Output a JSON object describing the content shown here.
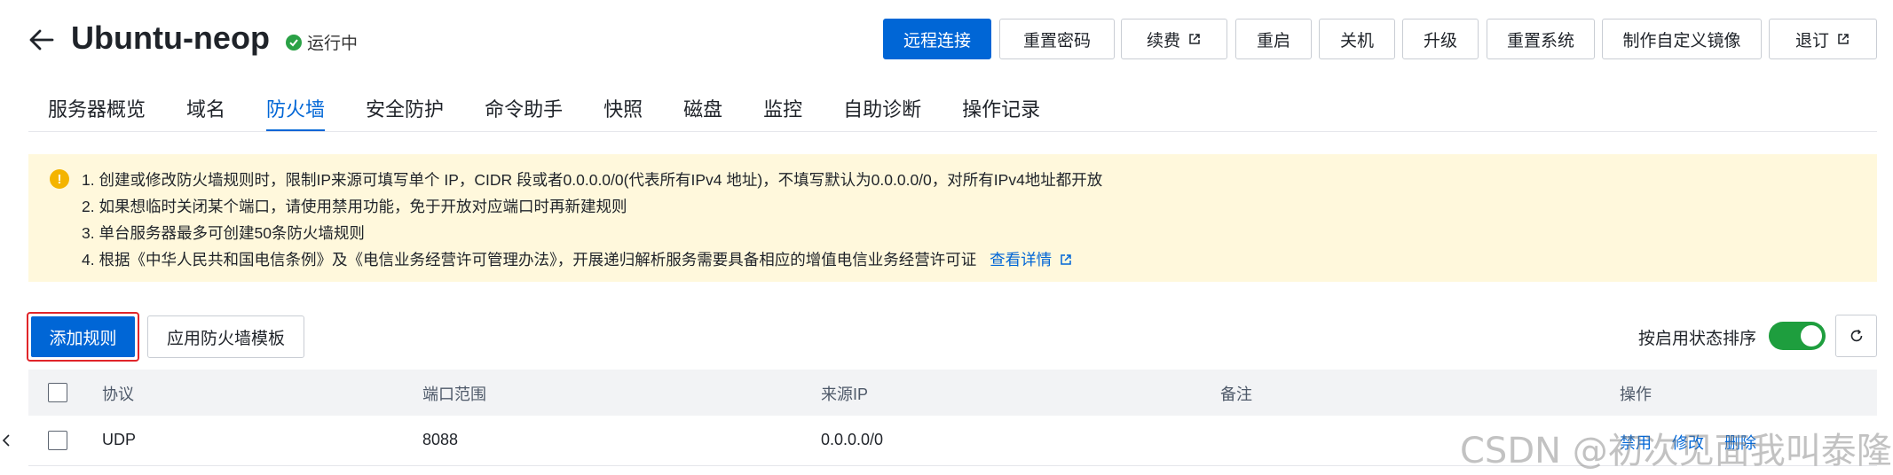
{
  "header": {
    "title": "Ubuntu-neop",
    "status": "运行中"
  },
  "actions": {
    "remote_connect": "远程连接",
    "reset_password": "重置密码",
    "renew": "续费",
    "restart": "重启",
    "shutdown": "关机",
    "upgrade": "升级",
    "reset_system": "重置系统",
    "custom_image": "制作自定义镜像",
    "refund": "退订"
  },
  "tabs": [
    {
      "label": "服务器概览"
    },
    {
      "label": "域名"
    },
    {
      "label": "防火墙"
    },
    {
      "label": "安全防护"
    },
    {
      "label": "命令助手"
    },
    {
      "label": "快照"
    },
    {
      "label": "磁盘"
    },
    {
      "label": "监控"
    },
    {
      "label": "自助诊断"
    },
    {
      "label": "操作记录"
    }
  ],
  "notice": {
    "lines": [
      "1. 创建或修改防火墙规则时，限制IP来源可填写单个 IP，CIDR 段或者0.0.0.0/0(代表所有IPv4 地址)，不填写默认为0.0.0.0/0，对所有IPv4地址都开放",
      "2. 如果想临时关闭某个端口，请使用禁用功能，免于开放对应端口时再新建规则",
      "3. 单台服务器最多可创建50条防火墙规则",
      "4. 根据《中华人民共和国电信条例》及《电信业务经营许可管理办法》，开展递归解析服务需要具备相应的增值电信业务经营许可证"
    ],
    "link": "查看详情"
  },
  "toolbar": {
    "add_rule": "添加规则",
    "apply_template": "应用防火墙模板",
    "sort_label": "按启用状态排序",
    "sort_enabled": true
  },
  "table": {
    "headers": {
      "protocol": "协议",
      "port_range": "端口范围",
      "source_ip": "来源IP",
      "remark": "备注",
      "actions": "操作"
    },
    "rows": [
      {
        "protocol": "UDP",
        "port_range": "8088",
        "source_ip": "0.0.0.0/0",
        "remark": "",
        "disable": "禁用",
        "edit": "修改",
        "delete": "删除"
      }
    ]
  },
  "watermark": "CSDN @初次见面我叫泰隆",
  "colors": {
    "primary": "#0066d6",
    "status_green": "#2aa146",
    "toggle_on": "#1e9e3e",
    "notice_bg": "#fff8dc",
    "highlight_border": "#e0252a"
  },
  "icons": {
    "back": "arrow-left-icon",
    "status": "check-circle-icon",
    "external": "external-link-icon",
    "warning": "warning-icon",
    "refresh": "refresh-icon",
    "side": "chevron-left-icon"
  }
}
